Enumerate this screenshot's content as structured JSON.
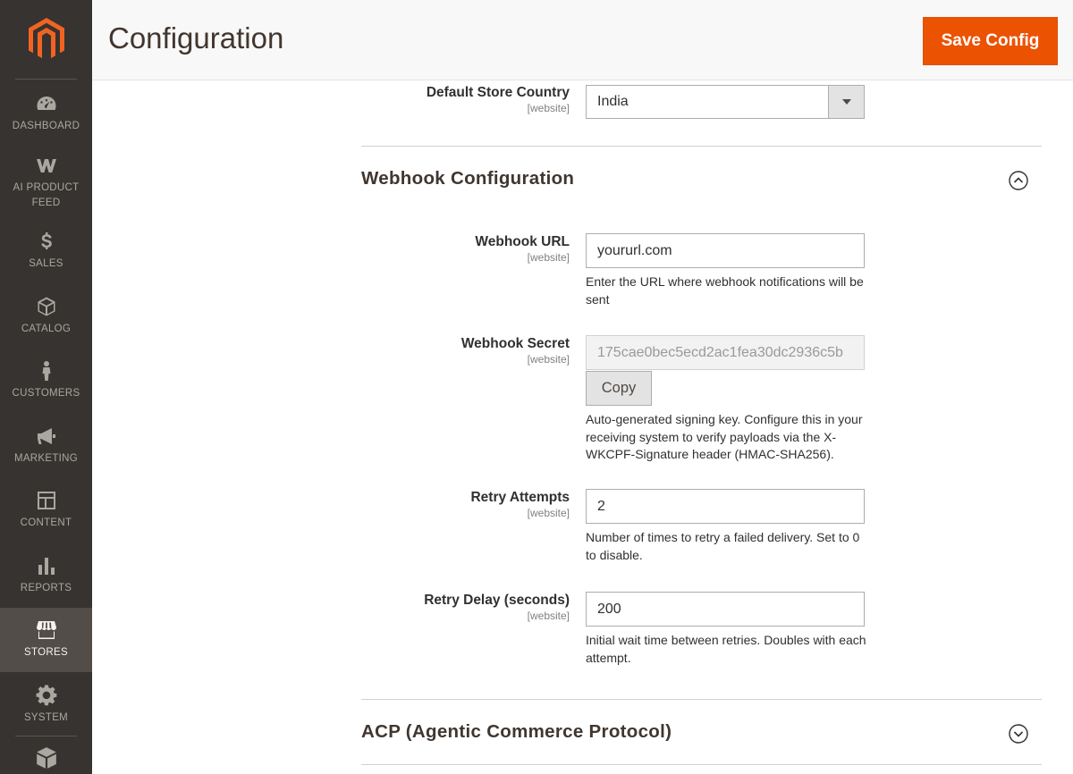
{
  "app": {
    "brand": "Magento",
    "page_title": "Configuration",
    "save_label": "Save Config"
  },
  "sidebar": {
    "items": [
      {
        "label": "DASHBOARD",
        "icon": "dashboard-icon"
      },
      {
        "label": "AI PRODUCT FEED",
        "icon": "w-logo-icon"
      },
      {
        "label": "SALES",
        "icon": "dollar-icon"
      },
      {
        "label": "CATALOG",
        "icon": "cube-icon"
      },
      {
        "label": "CUSTOMERS",
        "icon": "person-icon"
      },
      {
        "label": "MARKETING",
        "icon": "megaphone-icon"
      },
      {
        "label": "CONTENT",
        "icon": "layout-icon"
      },
      {
        "label": "REPORTS",
        "icon": "bar-chart-icon"
      },
      {
        "label": "STORES",
        "icon": "store-icon",
        "active": true
      },
      {
        "label": "SYSTEM",
        "icon": "gear-icon"
      }
    ],
    "extra_icon": "extensions-icon"
  },
  "default_store_country": {
    "label": "Default Store Country",
    "scope": "[website]",
    "value": "India"
  },
  "webhook_section": {
    "title": "Webhook Configuration",
    "expanded": true,
    "fields": {
      "url": {
        "label": "Webhook URL",
        "scope": "[website]",
        "value": "yoururl.com",
        "note": "Enter the URL where webhook notifications will be sent"
      },
      "secret": {
        "label": "Webhook Secret",
        "scope": "[website]",
        "value": "175cae0bec5ecd2ac1fea30dc2936c5b",
        "copy_label": "Copy",
        "note": "Auto-generated signing key. Configure this in your receiving system to verify payloads via the X-WKCPF-Signature header (HMAC-SHA256)."
      },
      "retry_attempts": {
        "label": "Retry Attempts",
        "scope": "[website]",
        "value": "2",
        "note": "Number of times to retry a failed delivery. Set to 0 to disable."
      },
      "retry_delay": {
        "label": "Retry Delay (seconds)",
        "scope": "[website]",
        "value": "200",
        "note": "Initial wait time between retries. Doubles with each attempt."
      }
    }
  },
  "acp_section": {
    "title": "ACP (Agentic Commerce Protocol)",
    "expanded": false
  },
  "colors": {
    "accent": "#eb5202",
    "sidebar_bg": "#373330",
    "sidebar_active": "#524d49"
  }
}
